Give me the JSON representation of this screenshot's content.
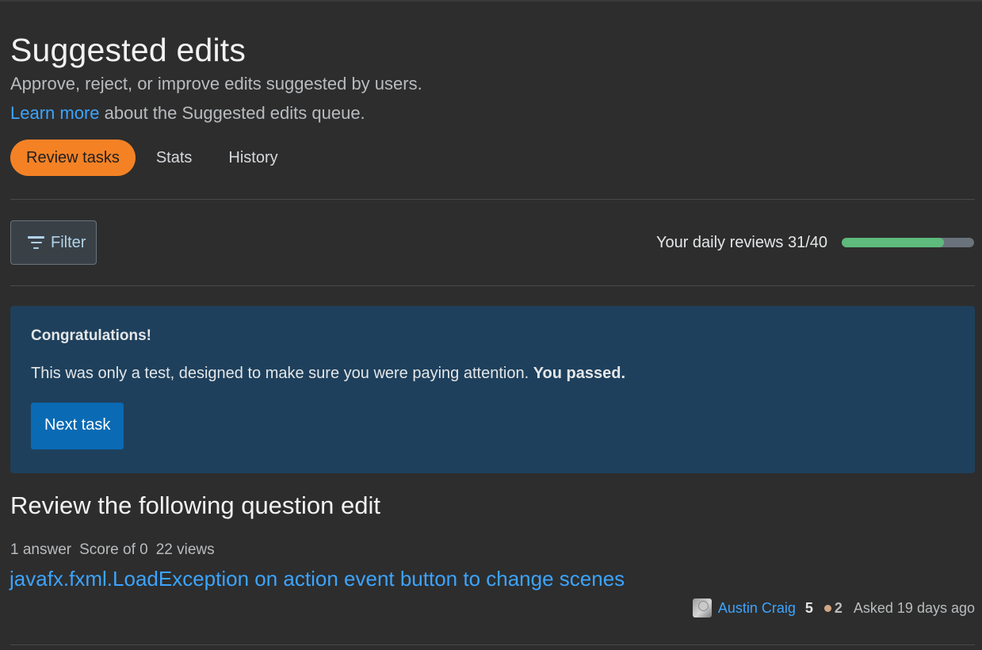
{
  "page": {
    "title": "Suggested edits",
    "subtitle": "Approve, reject, or improve edits suggested by users.",
    "learn_link": "Learn more",
    "learn_rest": " about the Suggested edits queue."
  },
  "tabs": [
    {
      "label": "Review tasks",
      "active": true
    },
    {
      "label": "Stats",
      "active": false
    },
    {
      "label": "History",
      "active": false
    }
  ],
  "toolbar": {
    "filter_label": "Filter",
    "filter_icon": "filter-icon",
    "daily_label": "Your daily reviews 31/40",
    "daily_done": 31,
    "daily_total": 40
  },
  "notice": {
    "title": "Congratulations!",
    "message": "This was only a test, designed to make sure you were paying attention.",
    "message_bold": "You passed.",
    "next_label": "Next task"
  },
  "review": {
    "heading": "Review the following question edit",
    "answers": "1 answer",
    "score": "Score of 0",
    "views": "22 views",
    "question_title": "javafx.fxml.LoadException on action event button to change scenes",
    "author": "Austin Craig",
    "reputation": "5",
    "bronze_badges": "2",
    "asked": "Asked 19 days ago"
  },
  "colors": {
    "background": "#2d2d2d",
    "accent_orange": "#f48225",
    "link_blue": "#3ca4ff",
    "notice_bg": "#1e405c",
    "button_blue": "#0a6ab3",
    "progress_green": "#5eba7d",
    "bronze": "#d1a684"
  }
}
